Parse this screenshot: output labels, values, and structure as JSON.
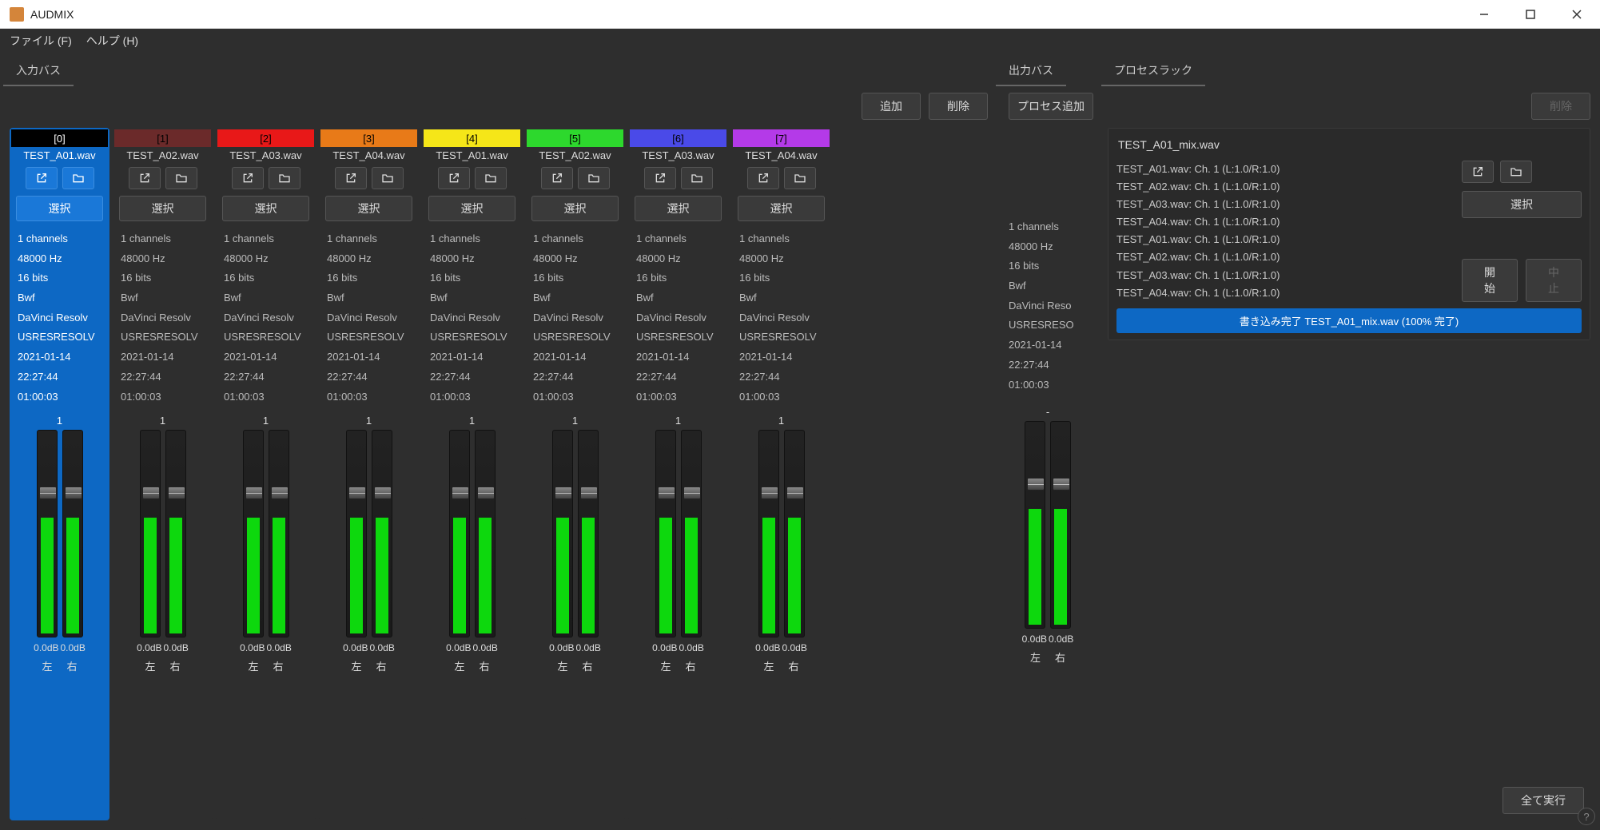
{
  "app_title": "AUDMIX",
  "menubar": {
    "file": "ファイル (F)",
    "help": "ヘルプ (H)"
  },
  "tabs": {
    "input": "入力バス",
    "output": "出力バス",
    "rack": "プロセスラック"
  },
  "buttons": {
    "add": "追加",
    "delete": "削除",
    "select": "選択",
    "process_add": "プロセス追加",
    "start": "開始",
    "stop": "中止",
    "run_all": "全て実行"
  },
  "labels": {
    "left": "左",
    "right": "右"
  },
  "input_channels": [
    {
      "idx": "[0]",
      "color": "#000000",
      "textcolor": "#fff",
      "file": "TEST_A01.wav",
      "info": [
        "1 channels",
        "48000 Hz",
        "16 bits",
        "Bwf",
        "DaVinci Resolv",
        "USRESRESOLV",
        "2021-01-14",
        "22:27:44",
        "01:00:03"
      ],
      "val": "1",
      "db": [
        "0.0dB",
        "0.0dB"
      ],
      "selected": true,
      "meter": 145,
      "knob": 70
    },
    {
      "idx": "[1]",
      "color": "#6b2a2a",
      "textcolor": "#000",
      "file": "TEST_A02.wav",
      "info": [
        "1 channels",
        "48000 Hz",
        "16 bits",
        "Bwf",
        "DaVinci Resolv",
        "USRESRESOLV",
        "2021-01-14",
        "22:27:44",
        "01:00:03"
      ],
      "val": "1",
      "db": [
        "0.0dB",
        "0.0dB"
      ],
      "selected": false,
      "meter": 145,
      "knob": 70
    },
    {
      "idx": "[2]",
      "color": "#e81818",
      "textcolor": "#000",
      "file": "TEST_A03.wav",
      "info": [
        "1 channels",
        "48000 Hz",
        "16 bits",
        "Bwf",
        "DaVinci Resolv",
        "USRESRESOLV",
        "2021-01-14",
        "22:27:44",
        "01:00:03"
      ],
      "val": "1",
      "db": [
        "0.0dB",
        "0.0dB"
      ],
      "selected": false,
      "meter": 145,
      "knob": 70
    },
    {
      "idx": "[3]",
      "color": "#e87a18",
      "textcolor": "#000",
      "file": "TEST_A04.wav",
      "info": [
        "1 channels",
        "48000 Hz",
        "16 bits",
        "Bwf",
        "DaVinci Resolv",
        "USRESRESOLV",
        "2021-01-14",
        "22:27:44",
        "01:00:03"
      ],
      "val": "1",
      "db": [
        "0.0dB",
        "0.0dB"
      ],
      "selected": false,
      "meter": 145,
      "knob": 70
    },
    {
      "idx": "[4]",
      "color": "#f5e618",
      "textcolor": "#000",
      "file": "TEST_A01.wav",
      "info": [
        "1 channels",
        "48000 Hz",
        "16 bits",
        "Bwf",
        "DaVinci Resolv",
        "USRESRESOLV",
        "2021-01-14",
        "22:27:44",
        "01:00:03"
      ],
      "val": "1",
      "db": [
        "0.0dB",
        "0.0dB"
      ],
      "selected": false,
      "meter": 145,
      "knob": 70
    },
    {
      "idx": "[5]",
      "color": "#2dd82d",
      "textcolor": "#000",
      "file": "TEST_A02.wav",
      "info": [
        "1 channels",
        "48000 Hz",
        "16 bits",
        "Bwf",
        "DaVinci Resolv",
        "USRESRESOLV",
        "2021-01-14",
        "22:27:44",
        "01:00:03"
      ],
      "val": "1",
      "db": [
        "0.0dB",
        "0.0dB"
      ],
      "selected": false,
      "meter": 145,
      "knob": 70
    },
    {
      "idx": "[6]",
      "color": "#4a4ae8",
      "textcolor": "#000",
      "file": "TEST_A03.wav",
      "info": [
        "1 channels",
        "48000 Hz",
        "16 bits",
        "Bwf",
        "DaVinci Resolv",
        "USRESRESOLV",
        "2021-01-14",
        "22:27:44",
        "01:00:03"
      ],
      "val": "1",
      "db": [
        "0.0dB",
        "0.0dB"
      ],
      "selected": false,
      "meter": 145,
      "knob": 70
    },
    {
      "idx": "[7]",
      "color": "#b43ae8",
      "textcolor": "#000",
      "file": "TEST_A04.wav",
      "info": [
        "1 channels",
        "48000 Hz",
        "16 bits",
        "Bwf",
        "DaVinci Resolv",
        "USRESRESOLV",
        "2021-01-14",
        "22:27:44",
        "01:00:03"
      ],
      "val": "1",
      "db": [
        "0.0dB",
        "0.0dB"
      ],
      "selected": false,
      "meter": 145,
      "knob": 70
    }
  ],
  "output_channel": {
    "info": [
      "1 channels",
      "48000 Hz",
      "16 bits",
      "Bwf",
      "DaVinci Reso",
      "USRESRESO",
      "2021-01-14",
      "22:27:44",
      "01:00:03"
    ],
    "val": "-",
    "db": [
      "0.0dB",
      "0.0dB"
    ],
    "meter": 145,
    "knob": 70
  },
  "rack": {
    "title": "TEST_A01_mix.wav",
    "list": [
      "TEST_A01.wav:  Ch. 1 (L:1.0/R:1.0)",
      "TEST_A02.wav:  Ch. 1 (L:1.0/R:1.0)",
      "TEST_A03.wav:  Ch. 1 (L:1.0/R:1.0)",
      "TEST_A04.wav:  Ch. 1 (L:1.0/R:1.0)",
      "TEST_A01.wav:  Ch. 1 (L:1.0/R:1.0)",
      "TEST_A02.wav:  Ch. 1 (L:1.0/R:1.0)",
      "TEST_A03.wav:  Ch. 1 (L:1.0/R:1.0)",
      "TEST_A04.wav:  Ch. 1 (L:1.0/R:1.0)"
    ],
    "status": "書き込み完了 TEST_A01_mix.wav (100% 完了)"
  }
}
